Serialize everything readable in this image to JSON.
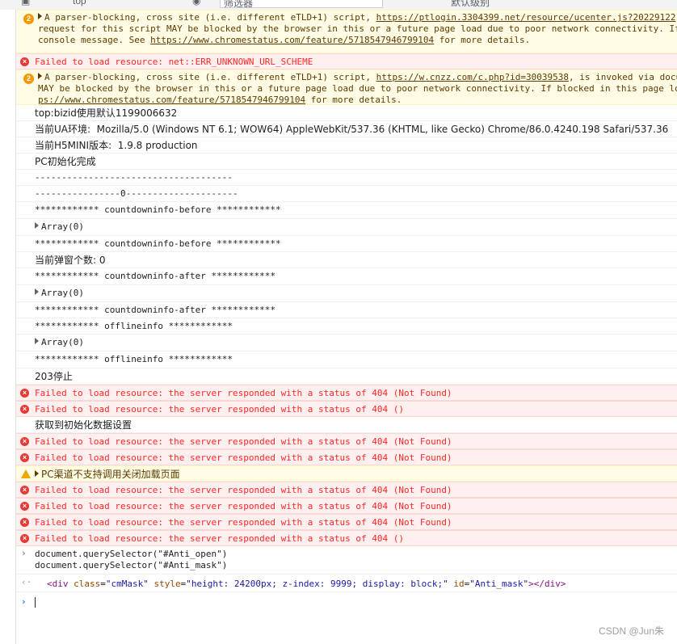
{
  "toolbar": {
    "context": "top",
    "filter_placeholder": "筛选器",
    "levels": "默认级别"
  },
  "messages": [
    {
      "kind": "warn-multi",
      "count": "2",
      "lines": [
        {
          "pre": "A parser-blocking, cross site (i.e. different eTLD+1) script, ",
          "link": "https://ptlogin.3304399.net/resource/ucenter.js?20229122",
          "post": ""
        },
        {
          "pre": "request for this script MAY be blocked by the browser in this or a future page load due to poor network connectivity. If",
          "link": "",
          "post": ""
        },
        {
          "pre": "console message. See ",
          "link": "https://www.chromestatus.com/feature/5718547946799104",
          "post": " for more details."
        }
      ]
    },
    {
      "kind": "err",
      "text": "Failed to load resource: net::ERR_UNKNOWN_URL_SCHEME"
    },
    {
      "kind": "warn-multi",
      "count": "2",
      "lines": [
        {
          "pre": "A parser-blocking, cross site (i.e. different eTLD+1) script, ",
          "link": "https://w.cnzz.com/c.php?id=30039538",
          "post": ", is invoked via docu"
        },
        {
          "pre": "MAY be blocked by the browser in this or a future page load due to poor network connectivity. If blocked in this page lo",
          "link": "",
          "post": ""
        },
        {
          "pre": "",
          "link": "ps://www.chromestatus.com/feature/5718547946799104",
          "post": " for more details."
        }
      ]
    },
    {
      "kind": "log",
      "text": "top:bizid使用默认1199006632"
    },
    {
      "kind": "log",
      "text": "当前UA环境:  Mozilla/5.0 (Windows NT 6.1; WOW64) AppleWebKit/537.36 (KHTML, like Gecko) Chrome/86.0.4240.198 Safari/537.36"
    },
    {
      "kind": "log",
      "text": "当前H5MINI版本:  1.9.8 production"
    },
    {
      "kind": "log",
      "text": "PC初始化完成"
    },
    {
      "kind": "log",
      "text": "-------------------------------------"
    },
    {
      "kind": "log",
      "text": "----------------0---------------------"
    },
    {
      "kind": "log",
      "text": "************ countdowninfo-before ************"
    },
    {
      "kind": "arr",
      "text": "Array(0)"
    },
    {
      "kind": "log",
      "text": "************ countdowninfo-before ************"
    },
    {
      "kind": "log",
      "text": "当前弹窗个数: 0"
    },
    {
      "kind": "log",
      "text": "************ countdowninfo-after ************"
    },
    {
      "kind": "arr",
      "text": "Array(0)"
    },
    {
      "kind": "log",
      "text": "************ countdowninfo-after ************"
    },
    {
      "kind": "log",
      "text": "************ offlineinfo ************"
    },
    {
      "kind": "arr",
      "text": "Array(0)"
    },
    {
      "kind": "log",
      "text": "************ offlineinfo ************"
    },
    {
      "kind": "log",
      "text": "203停止"
    },
    {
      "kind": "err",
      "text": "Failed to load resource: the server responded with a status of 404 (Not Found)"
    },
    {
      "kind": "err",
      "text": "Failed to load resource: the server responded with a status of 404 ()"
    },
    {
      "kind": "log",
      "text": "获取到初始化数据设置"
    },
    {
      "kind": "err",
      "text": "Failed to load resource: the server responded with a status of 404 (Not Found)"
    },
    {
      "kind": "err",
      "text": "Failed to load resource: the server responded with a status of 404 (Not Found)"
    },
    {
      "kind": "warn",
      "text": "PC渠道不支持调用关闭加载页面"
    },
    {
      "kind": "err",
      "text": "Failed to load resource: the server responded with a status of 404 (Not Found)"
    },
    {
      "kind": "err",
      "text": "Failed to load resource: the server responded with a status of 404 (Not Found)"
    },
    {
      "kind": "err",
      "text": "Failed to load resource: the server responded with a status of 404 (Not Found)"
    },
    {
      "kind": "err",
      "text": "Failed to load resource: the server responded with a status of 404 ()"
    }
  ],
  "input": {
    "line1": "document.querySelector(\"#Anti_open\")",
    "line2": "document.querySelector(\"#Anti_mask\")"
  },
  "result": {
    "open": "<div",
    "attr1": "class",
    "val1": "\"cmMask\"",
    "attr2": "style",
    "val2": "\"height: 24200px; z-index: 9999; display: block;\"",
    "attr3": "id",
    "val3": "\"Anti_mask\"",
    "close": "></div>"
  },
  "prompt": {
    "glyph": "›"
  },
  "watermark": "CSDN @Jun朱"
}
